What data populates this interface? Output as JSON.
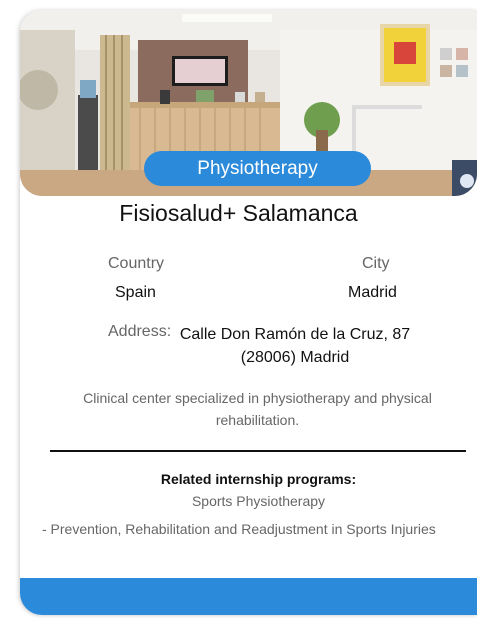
{
  "card": {
    "badge": "Physiotherapy",
    "title": "Fisiosalud+ Salamanca",
    "country_label": "Country",
    "country_value": "Spain",
    "city_label": "City",
    "city_value": "Madrid",
    "address_label": "Address:",
    "address_value": "Calle Don Ramón de la Cruz, 87 (28006) Madrid",
    "description": "Clinical center specialized in physiotherapy and physical rehabilitation.",
    "related_title": "Related internship programs:",
    "related_items": [
      "Sports Physiotherapy",
      "- Prevention, Rehabilitation and Readjustment in Sports Injuries"
    ]
  },
  "colors": {
    "accent": "#2b8ad9"
  }
}
